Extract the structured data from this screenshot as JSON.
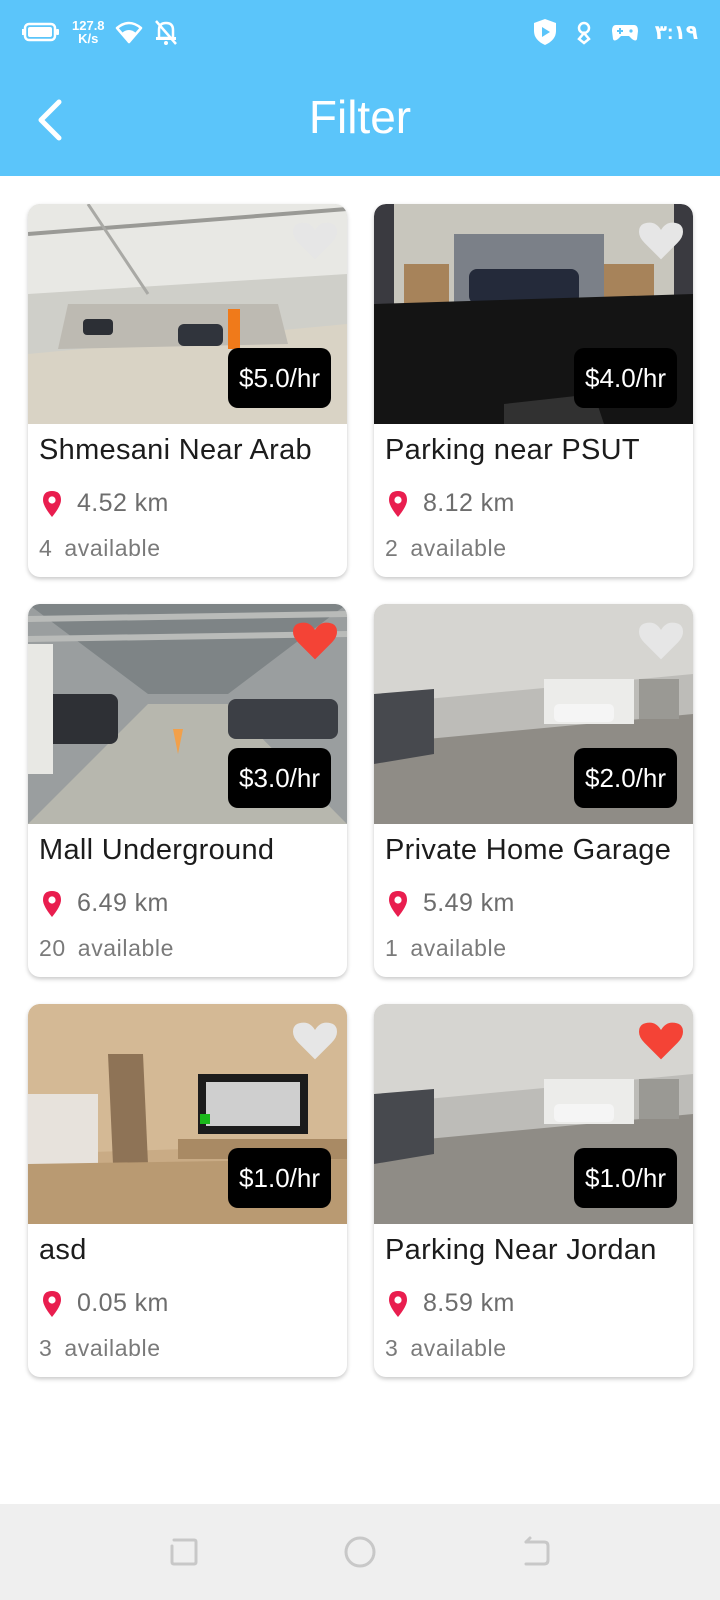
{
  "status_bar": {
    "net_speed_value": "127.8",
    "net_speed_unit": "K/s",
    "time": "٣:١٩",
    "icons": [
      "battery-icon",
      "wifi-icon",
      "notifications-off-icon",
      "shield-icon",
      "location-icon",
      "game-controller-icon"
    ]
  },
  "app_bar": {
    "title": "Filter",
    "back_icon": "chevron-left-icon"
  },
  "colors": {
    "primary": "#5bc5fa",
    "favorite_active": "#f44336",
    "favorite_inactive": "#e6e6e6",
    "pin": "#e91e4f",
    "price_bg": "#000000"
  },
  "listings": [
    {
      "name": "Shmesani Near Arab",
      "price": "$5.0/hr",
      "distance": "4.52 km",
      "available_count": "4",
      "available_label": "available",
      "favorite": false,
      "photo": "garage-photo"
    },
    {
      "name": "Parking near PSUT",
      "price": "$4.0/hr",
      "distance": "8.12 km",
      "available_count": "2",
      "available_label": "available",
      "favorite": false,
      "photo": "garage-photo"
    },
    {
      "name": "Mall Underground",
      "price": "$3.0/hr",
      "distance": "6.49 km",
      "available_count": "20",
      "available_label": "available",
      "favorite": true,
      "photo": "garage-photo"
    },
    {
      "name": "Private Home Garage",
      "price": "$2.0/hr",
      "distance": "5.49 km",
      "available_count": "1",
      "available_label": "available",
      "favorite": false,
      "photo": "garage-photo"
    },
    {
      "name": "asd",
      "price": "$1.0/hr",
      "distance": "0.05 km",
      "available_count": "3",
      "available_label": "available",
      "favorite": false,
      "photo": "room-photo"
    },
    {
      "name": "Parking Near Jordan",
      "price": "$1.0/hr",
      "distance": "8.59 km",
      "available_count": "3",
      "available_label": "available",
      "favorite": true,
      "photo": "garage-photo"
    }
  ],
  "nav_bar": {
    "buttons": [
      "recent-apps-icon",
      "home-icon",
      "back-icon"
    ]
  }
}
